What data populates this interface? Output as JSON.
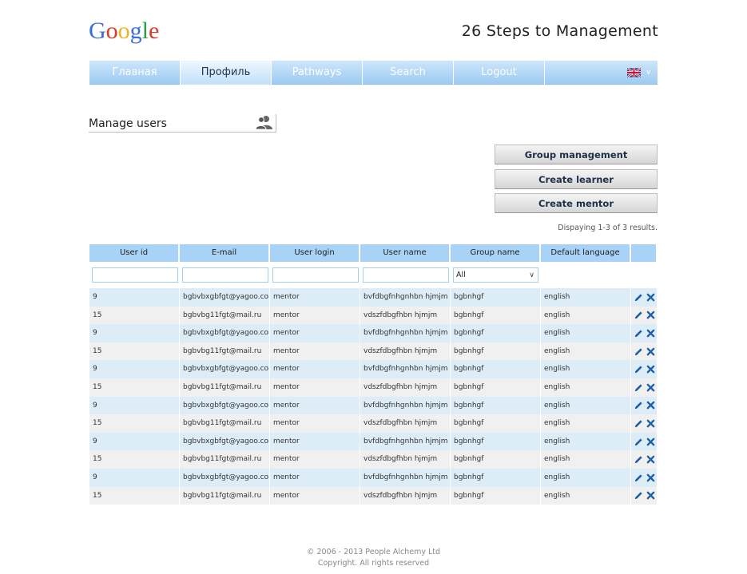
{
  "logo": {
    "text": "Google"
  },
  "site_title": "26 Steps to Management",
  "nav": {
    "items": [
      "Главная",
      "Профиль",
      "Pathways",
      "Search",
      "Logout"
    ],
    "active": "Профиль",
    "language_flag": "uk-flag-icon"
  },
  "manage": {
    "title": "Manage users",
    "icon": "users-icon"
  },
  "buttons": {
    "group_management": "Group management",
    "create_learner": "Create learner",
    "create_mentor": "Create mentor"
  },
  "results_info": "Dispaying 1-3 of 3 results.",
  "table": {
    "columns": [
      "User id",
      "E-mail",
      "User login",
      "User name",
      "Group name",
      "Default language"
    ],
    "filter_select_value": "All",
    "rows": [
      [
        "9",
        "bgbvbxgbfgt@yagoo.com",
        "mentor",
        "bvfdbgfnhgnhbn hjmjm",
        "bgbnhgf",
        "english"
      ],
      [
        "15",
        "bgbvbg11fgt@mail.ru",
        "mentor",
        "vdszfdbgfhbn hjmjm",
        "bgbnhgf",
        "english"
      ],
      [
        "9",
        "bgbvbxgbfgt@yagoo.com",
        "mentor",
        "bvfdbgfnhgnhbn hjmjm",
        "bgbnhgf",
        "english"
      ],
      [
        "15",
        "bgbvbg11fgt@mail.ru",
        "mentor",
        "vdszfdbgfhbn hjmjm",
        "bgbnhgf",
        "english"
      ],
      [
        "9",
        "bgbvbxgbfgt@yagoo.com",
        "mentor",
        "bvfdbgfnhgnhbn hjmjm",
        "bgbnhgf",
        "english"
      ],
      [
        "15",
        "bgbvbg11fgt@mail.ru",
        "mentor",
        "vdszfdbgfhbn hjmjm",
        "bgbnhgf",
        "english"
      ],
      [
        "9",
        "bgbvbxgbfgt@yagoo.com",
        "mentor",
        "bvfdbgfnhgnhbn hjmjm",
        "bgbnhgf",
        "english"
      ],
      [
        "15",
        "bgbvbg11fgt@mail.ru",
        "mentor",
        "vdszfdbgfhbn hjmjm",
        "bgbnhgf",
        "english"
      ],
      [
        "9",
        "bgbvbxgbfgt@yagoo.com",
        "mentor",
        "bvfdbgfnhgnhbn hjmjm",
        "bgbnhgf",
        "english"
      ],
      [
        "15",
        "bgbvbg11fgt@mail.ru",
        "mentor",
        "vdszfdbgfhbn hjmjm",
        "bgbnhgf",
        "english"
      ],
      [
        "9",
        "bgbvbxgbfgt@yagoo.com",
        "mentor",
        "bvfdbgfnhgnhbn hjmjm",
        "bgbnhgf",
        "english"
      ],
      [
        "15",
        "bgbvbg11fgt@mail.ru",
        "mentor",
        "vdszfdbgfhbn hjmjm",
        "bgbnhgf",
        "english"
      ]
    ],
    "row_actions": [
      "edit-pencil-icon",
      "delete-x-icon"
    ]
  },
  "footer": {
    "line1": "© 2006 - 2013 People Alchemy Ltd",
    "line2": "Copyright. All rights reserved"
  },
  "colors": {
    "nav_blue": "#a8d2f6",
    "row_blue": "#dcedf8",
    "row_gray": "#f0f0f0",
    "icon_blue": "#1c5fa8"
  }
}
